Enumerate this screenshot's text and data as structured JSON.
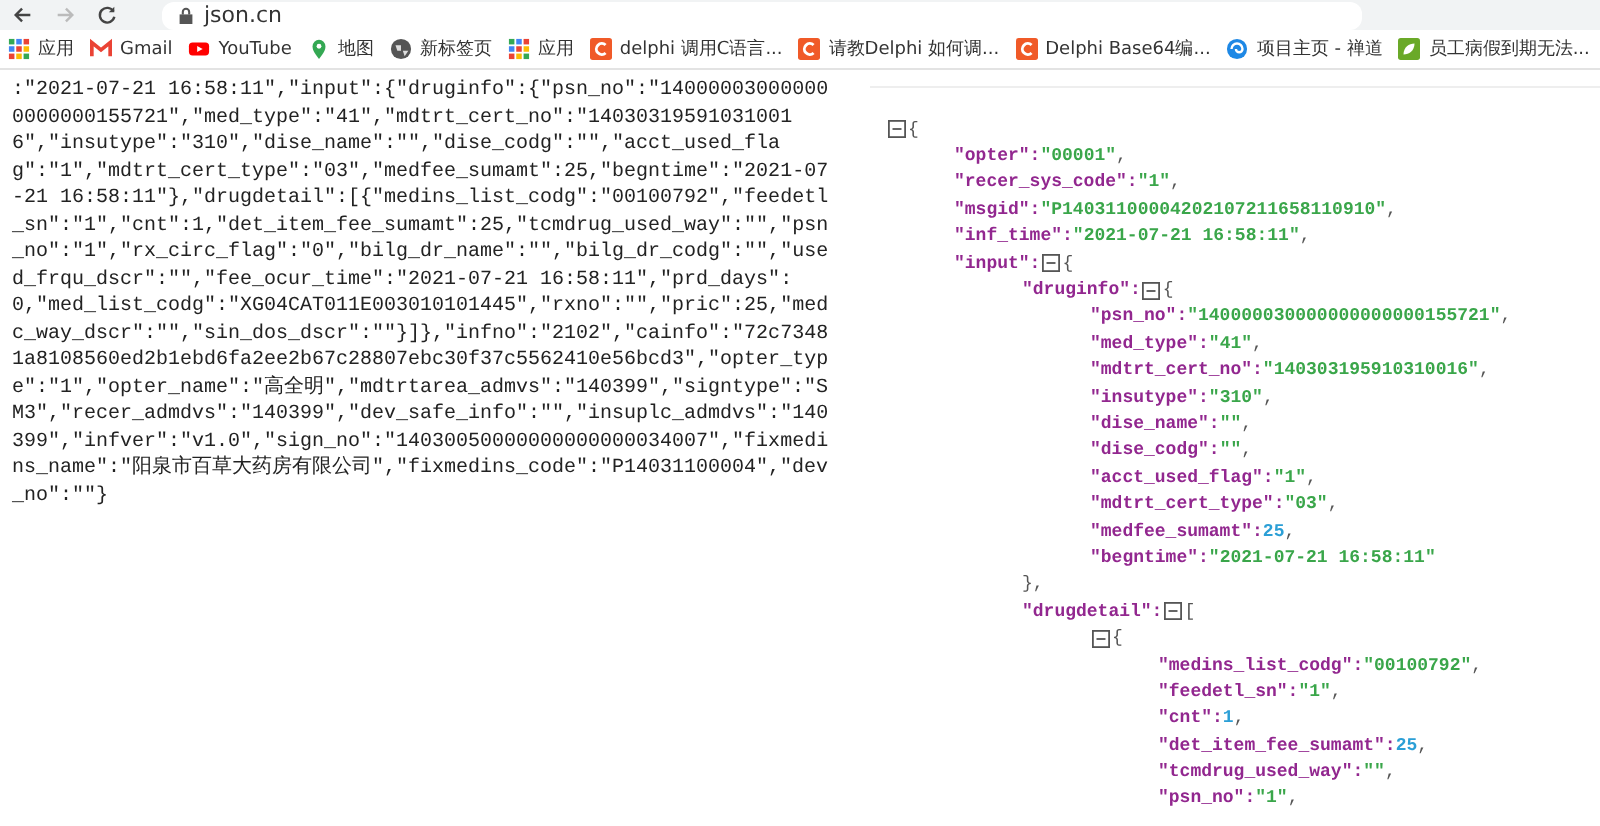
{
  "address_bar": {
    "url": "json.cn"
  },
  "bookmarks": [
    {
      "kind": "apps",
      "label": "应用"
    },
    {
      "kind": "gmail",
      "label": "Gmail"
    },
    {
      "kind": "youtube",
      "label": "YouTube"
    },
    {
      "kind": "maps",
      "label": "地图"
    },
    {
      "kind": "globe",
      "label": "新标签页"
    },
    {
      "kind": "apps",
      "label": "应用"
    },
    {
      "kind": "c-logo",
      "label": "delphi 调用C语言..."
    },
    {
      "kind": "c-logo",
      "label": "请教Delphi 如何调..."
    },
    {
      "kind": "c-logo",
      "label": "Delphi Base64编..."
    },
    {
      "kind": "swirl",
      "label": "项目主页 - 禅道"
    },
    {
      "kind": "leaf",
      "label": "员工病假到期无法..."
    }
  ],
  "raw_json_text": ":\"2021-07-21 16:58:11\",\"input\":{\"druginfo\":{\"psn_no\":\"140000030000000000000155721\",\"med_type\":\"41\",\"mdtrt_cert_no\":\"140303195910310016\",\"insutype\":\"310\",\"dise_name\":\"\",\"dise_codg\":\"\",\"acct_used_flag\":\"1\",\"mdtrt_cert_type\":\"03\",\"medfee_sumamt\":25,\"begntime\":\"2021-07-21 16:58:11\"},\"drugdetail\":[{\"medins_list_codg\":\"00100792\",\"feedetl_sn\":\"1\",\"cnt\":1,\"det_item_fee_sumamt\":25,\"tcmdrug_used_way\":\"\",\"psn_no\":\"1\",\"rx_circ_flag\":\"0\",\"bilg_dr_name\":\"\",\"bilg_dr_codg\":\"\",\"used_frqu_dscr\":\"\",\"fee_ocur_time\":\"2021-07-21 16:58:11\",\"prd_days\":0,\"med_list_codg\":\"XG04CAT011E003010101445\",\"rxno\":\"\",\"pric\":25,\"medc_way_dscr\":\"\",\"sin_dos_dscr\":\"\"}]},\"infno\":\"2102\",\"cainfo\":\"72c73481a8108560ed2b1ebd6fa2ee2b67c28807ebc30f37c5562410e56bcd3\",\"opter_type\":\"1\",\"opter_name\":\"高全明\",\"mdtrtarea_admvs\":\"140399\",\"signtype\":\"SM3\",\"recer_admdvs\":\"140399\",\"dev_safe_info\":\"\",\"insuplc_admdvs\":\"140399\",\"infver\":\"v1.0\",\"sign_no\":\"14030050000000000000034007\",\"fixmedins_name\":\"阳泉市百草大药房有限公司\",\"fixmedins_code\":\"P14031100004\",\"dev_no\":\"\"}",
  "json_tree": {
    "kind": "object",
    "open": "{",
    "expanded": true,
    "children": [
      {
        "kind": "string",
        "key": "\"opter\":",
        "value": "\"00001\"",
        "sep": ","
      },
      {
        "kind": "string",
        "key": "\"recer_sys_code\":",
        "value": "\"1\"",
        "sep": ","
      },
      {
        "kind": "string",
        "key": "\"msgid\":",
        "value": "\"P14031100004202107211658110910\"",
        "sep": ","
      },
      {
        "kind": "string",
        "key": "\"inf_time\":",
        "value": "\"2021-07-21  16:58:11\"",
        "sep": ","
      },
      {
        "kind": "object",
        "key": "\"input\":",
        "open": "{",
        "expanded": true,
        "children": [
          {
            "kind": "object",
            "key": "\"druginfo\":",
            "open": "{",
            "expanded": true,
            "close": "},",
            "children": [
              {
                "kind": "string",
                "key": "\"psn_no\":",
                "value": "\"140000030000000000000155721\"",
                "sep": ","
              },
              {
                "kind": "string",
                "key": "\"med_type\":",
                "value": "\"41\"",
                "sep": ","
              },
              {
                "kind": "string",
                "key": "\"mdtrt_cert_no\":",
                "value": "\"140303195910310016\"",
                "sep": ","
              },
              {
                "kind": "string",
                "key": "\"insutype\":",
                "value": "\"310\"",
                "sep": ","
              },
              {
                "kind": "string",
                "key": "\"dise_name\":",
                "value": "\"\"",
                "sep": ","
              },
              {
                "kind": "string",
                "key": "\"dise_codg\":",
                "value": "\"\"",
                "sep": ","
              },
              {
                "kind": "string",
                "key": "\"acct_used_flag\":",
                "value": "\"1\"",
                "sep": ","
              },
              {
                "kind": "string",
                "key": "\"mdtrt_cert_type\":",
                "value": "\"03\"",
                "sep": ","
              },
              {
                "kind": "number",
                "key": "\"medfee_sumamt\":",
                "value": "25",
                "sep": ","
              },
              {
                "kind": "string",
                "key": "\"begntime\":",
                "value": "\"2021-07-21  16:58:11\""
              }
            ]
          },
          {
            "kind": "object",
            "key": "\"drugdetail\":",
            "open": "[",
            "expanded": true,
            "children": [
              {
                "kind": "object",
                "open": "{",
                "expanded": true,
                "children": [
                  {
                    "kind": "string",
                    "key": "\"medins_list_codg\":",
                    "value": "\"00100792\"",
                    "sep": ","
                  },
                  {
                    "kind": "string",
                    "key": "\"feedetl_sn\":",
                    "value": "\"1\"",
                    "sep": ","
                  },
                  {
                    "kind": "number",
                    "key": "\"cnt\":",
                    "value": "1",
                    "sep": ","
                  },
                  {
                    "kind": "number",
                    "key": "\"det_item_fee_sumamt\":",
                    "value": "25",
                    "sep": ","
                  },
                  {
                    "kind": "string",
                    "key": "\"tcmdrug_used_way\":",
                    "value": "\"\"",
                    "sep": ","
                  },
                  {
                    "kind": "string",
                    "key": "\"psn_no\":",
                    "value": "\"1\"",
                    "sep": ","
                  }
                ]
              }
            ]
          }
        ]
      }
    ]
  }
}
